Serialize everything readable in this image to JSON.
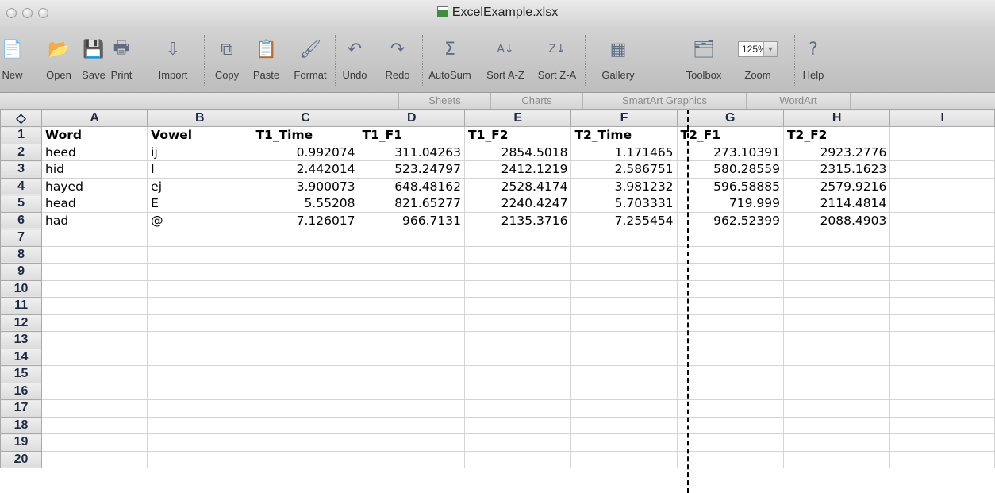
{
  "window": {
    "title": "ExcelExample.xlsx"
  },
  "toolbar": {
    "buttons": [
      {
        "label": "New",
        "icon": "new-document-icon"
      },
      {
        "label": "Open",
        "icon": "open-folder-icon"
      },
      {
        "label": "Save",
        "icon": "floppy-disk-icon"
      },
      {
        "label": "Print",
        "icon": "printer-icon"
      },
      {
        "label": "Import",
        "icon": "import-icon"
      },
      {
        "label": "Copy",
        "icon": "copy-icon"
      },
      {
        "label": "Paste",
        "icon": "paste-icon"
      },
      {
        "label": "Format",
        "icon": "format-brush-icon"
      },
      {
        "label": "Undo",
        "icon": "undo-icon"
      },
      {
        "label": "Redo",
        "icon": "redo-icon"
      },
      {
        "label": "AutoSum",
        "icon": "sigma-icon"
      },
      {
        "label": "Sort A-Z",
        "icon": "sort-az-icon"
      },
      {
        "label": "Sort Z-A",
        "icon": "sort-za-icon"
      },
      {
        "label": "Gallery",
        "icon": "gallery-icon"
      },
      {
        "label": "Toolbox",
        "icon": "toolbox-icon"
      },
      {
        "label": "Zoom",
        "icon": "zoom-icon"
      },
      {
        "label": "Help",
        "icon": "help-icon"
      }
    ],
    "zoom_value": "125%"
  },
  "ribbon": {
    "tabs": [
      "Sheets",
      "Charts",
      "SmartArt Graphics",
      "WordArt"
    ]
  },
  "sheet": {
    "corner": "◇",
    "columns": [
      "A",
      "B",
      "C",
      "D",
      "E",
      "F",
      "G",
      "H",
      "I"
    ],
    "row_numbers": [
      "1",
      "2",
      "3",
      "4",
      "5",
      "6",
      "7",
      "8",
      "9",
      "10",
      "11",
      "12",
      "13",
      "14",
      "15",
      "16",
      "17",
      "18",
      "19",
      "20"
    ],
    "rows": [
      [
        "Word",
        "Vowel",
        "T1_Time",
        "T1_F1",
        "T1_F2",
        "T2_Time",
        "T2_F1",
        "T2_F2",
        ""
      ],
      [
        "heed",
        "ij",
        "0.992074",
        "311.04263",
        "2854.5018",
        "1.171465",
        "273.10391",
        "2923.2776",
        ""
      ],
      [
        "hid",
        "I",
        "2.442014",
        "523.24797",
        "2412.1219",
        "2.586751",
        "580.28559",
        "2315.1623",
        ""
      ],
      [
        "hayed",
        "ej",
        "3.900073",
        "648.48162",
        "2528.4174",
        "3.981232",
        "596.58885",
        "2579.9216",
        ""
      ],
      [
        "head",
        "E",
        "5.55208",
        "821.65277",
        "2240.4247",
        "5.703331",
        "719.999",
        "2114.4814",
        ""
      ],
      [
        "had",
        "@",
        "7.126017",
        "966.7131",
        "2135.3716",
        "7.255454",
        "962.52399",
        "2088.4903",
        ""
      ]
    ]
  }
}
